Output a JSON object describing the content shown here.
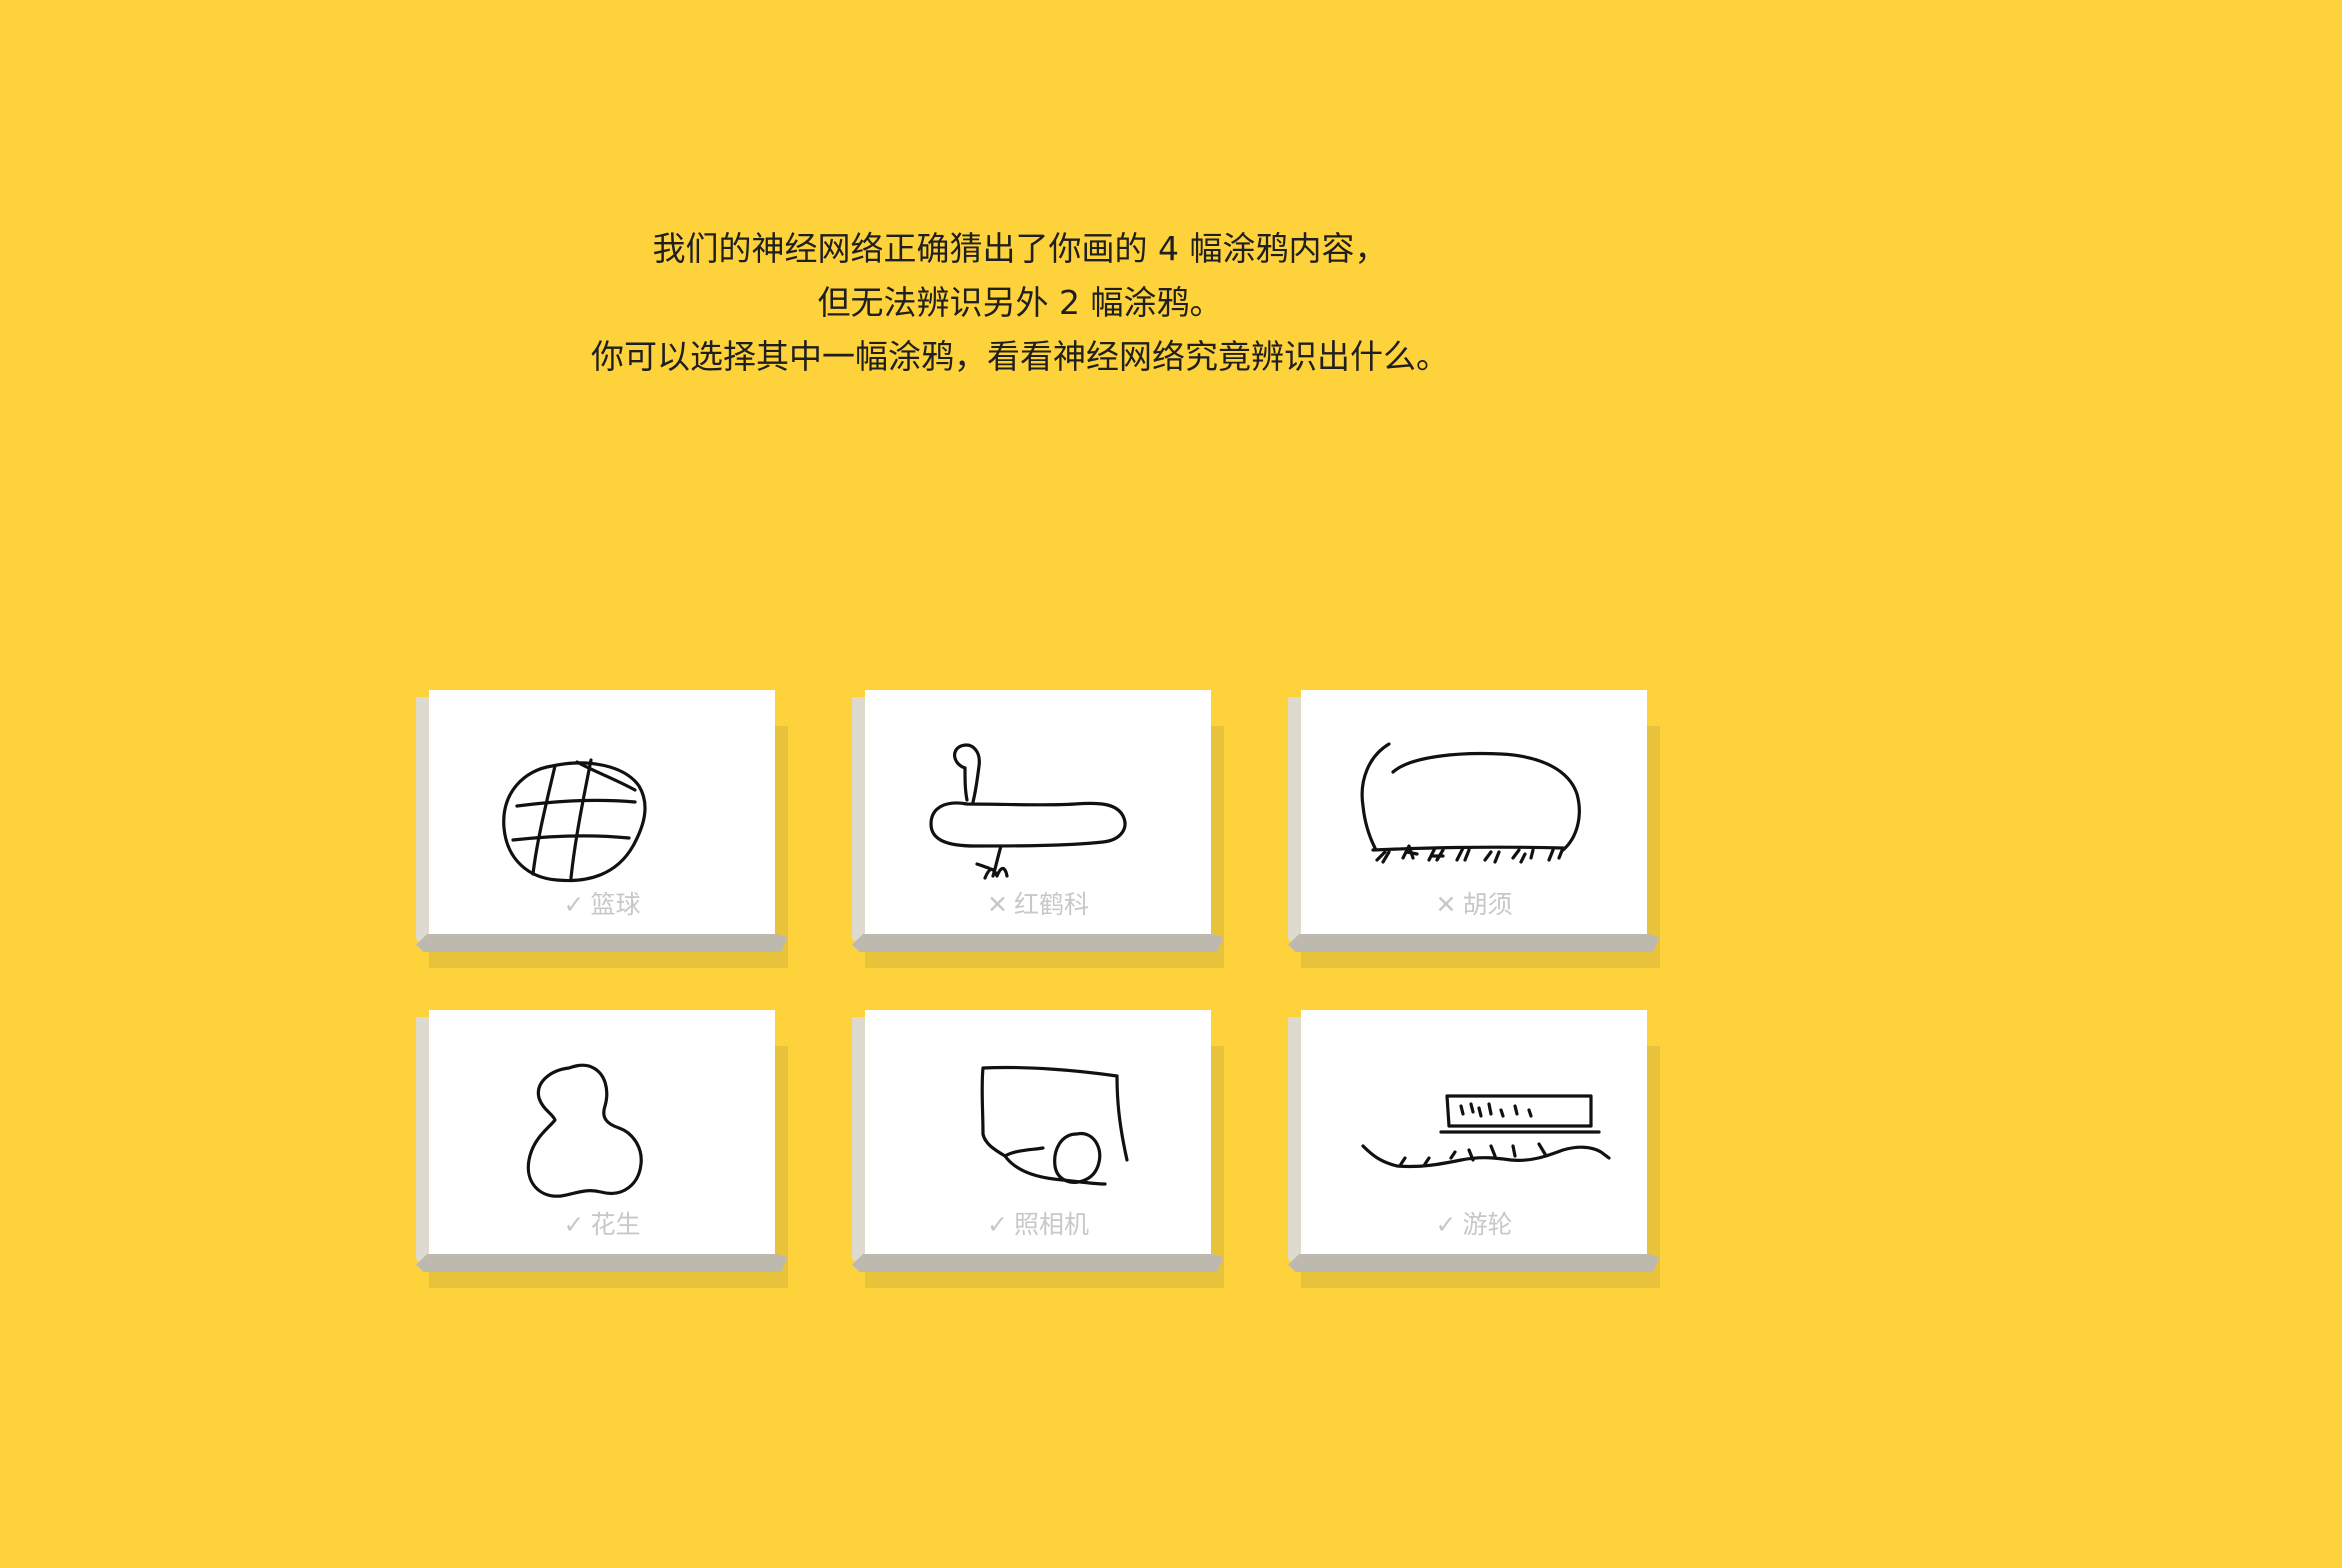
{
  "message": {
    "line1": "我们的神经网络正确猜出了你画的 4 幅涂鸦内容，",
    "line2": "但无法辨识另外 2 幅涂鸦。",
    "line3": "你可以选择其中一幅涂鸦，看看神经网络究竟辨识出什么。"
  },
  "cards": [
    {
      "mark": "✓",
      "label": "篮球",
      "recognized": true,
      "drawing": "basketball"
    },
    {
      "mark": "✕",
      "label": "红鹤科",
      "recognized": false,
      "drawing": "flamingo"
    },
    {
      "mark": "✕",
      "label": "胡须",
      "recognized": false,
      "drawing": "mustache"
    },
    {
      "mark": "✓",
      "label": "花生",
      "recognized": true,
      "drawing": "peanut"
    },
    {
      "mark": "✓",
      "label": "照相机",
      "recognized": true,
      "drawing": "camera"
    },
    {
      "mark": "✓",
      "label": "游轮",
      "recognized": true,
      "drawing": "cruise-ship"
    }
  ],
  "colors": {
    "background": "#FED23A",
    "card": "#FFFFFF",
    "caption": "#C8C8C8",
    "ink": "#111111"
  }
}
